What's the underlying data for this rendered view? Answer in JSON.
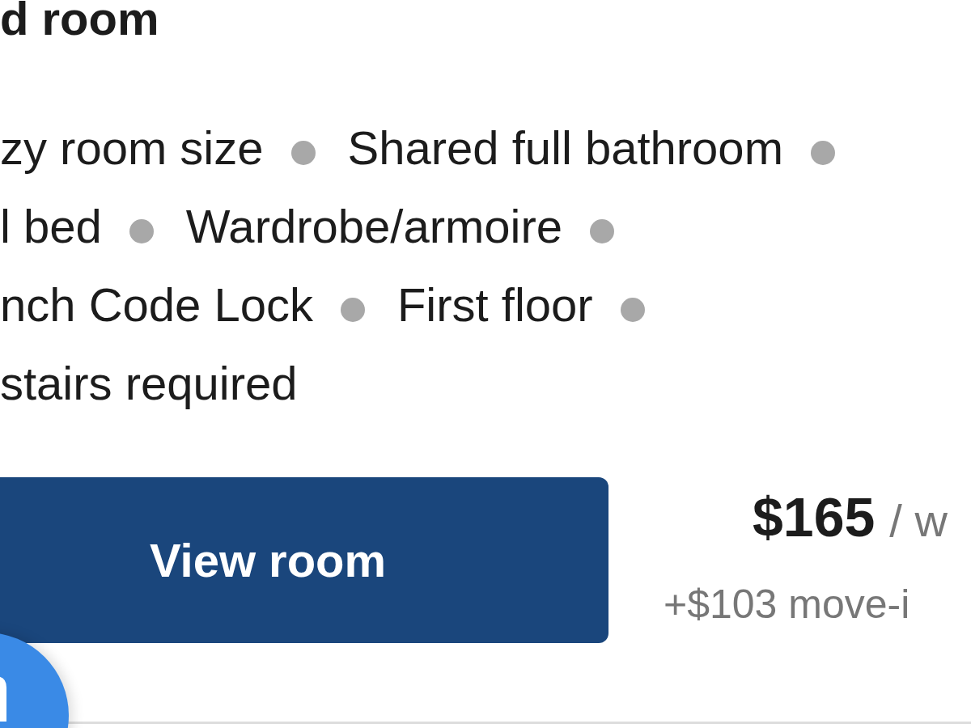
{
  "room": {
    "title": "d room",
    "amenity_rows": [
      [
        "zy room size",
        "Shared full bathroom"
      ],
      [
        "l bed",
        "Wardrobe/armoire"
      ],
      [
        "nch Code Lock",
        "First floor"
      ],
      [
        "stairs required"
      ]
    ],
    "button": "View room",
    "price": "$165",
    "price_unit": "/ w",
    "move_in_fee": "+$103 move-i"
  }
}
